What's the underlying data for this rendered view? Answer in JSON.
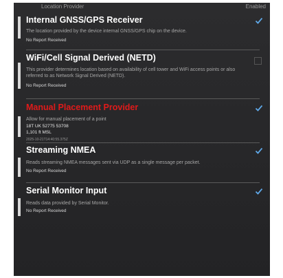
{
  "header": {
    "provider_label": "Location Provider",
    "enabled_label": "Enabled"
  },
  "providers": [
    {
      "title": "Internal GNSS/GPS Receiver",
      "description": "The location provided by the device internal GNSS/GPS chip on the device.",
      "status": "No Report Received",
      "enabled": true
    },
    {
      "title": "WiFi/Cell Signal Derived (NETD)",
      "description": "This provider determines location based on availability of cell tower and WiFi access points or also referred to as Network Signal Derived (NETD).",
      "status": "No Report Received",
      "enabled": false
    },
    {
      "title": "Manual Placement Provider",
      "description": "Allow for manual placement of a point",
      "coordinate": "18T UK 52775 53708",
      "altitude": "1,101 ft MSL",
      "timestamp": "2025-10-21T14:40:55.375Z",
      "enabled": true,
      "title_color": "#e01a1a"
    },
    {
      "title": "Streaming NMEA",
      "description": "Reads streaming NMEA messages sent via UDP as a single message per packet.",
      "status": "No Report Received",
      "enabled": true
    },
    {
      "title": "Serial Monitor Input",
      "description": "Reads data provided by Serial Monitor.",
      "status": "No Report Received",
      "enabled": true
    }
  ],
  "colors": {
    "background": "#2a2a2c",
    "check_accent": "#5fa8e8",
    "manual_title": "#e01a1a"
  }
}
